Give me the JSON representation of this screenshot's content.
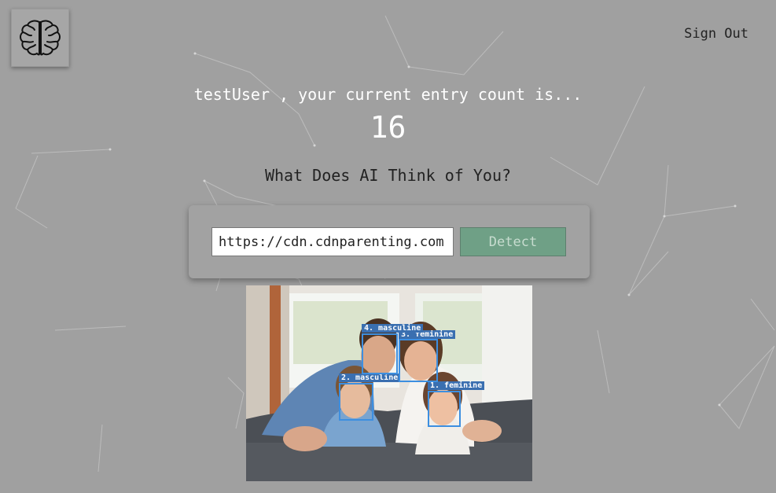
{
  "header": {
    "logo_icon": "brain-icon",
    "sign_out_label": "Sign Out"
  },
  "greeting": {
    "text": "testUser , your current entry count is...",
    "count": "16"
  },
  "prompt": {
    "question": "What Does AI Think of You?"
  },
  "form": {
    "url_value": "https://cdn.cdnparenting.com",
    "detect_label": "Detect"
  },
  "detections": [
    {
      "label": "1. feminine"
    },
    {
      "label": "2. masculine"
    },
    {
      "label": "3. feminine"
    },
    {
      "label": "4. masculine"
    }
  ],
  "colors": {
    "background": "#a0a0a0",
    "detect_button": "#6fa086",
    "face_box": "#3d8fe0",
    "face_label": "#3a6fb0"
  }
}
